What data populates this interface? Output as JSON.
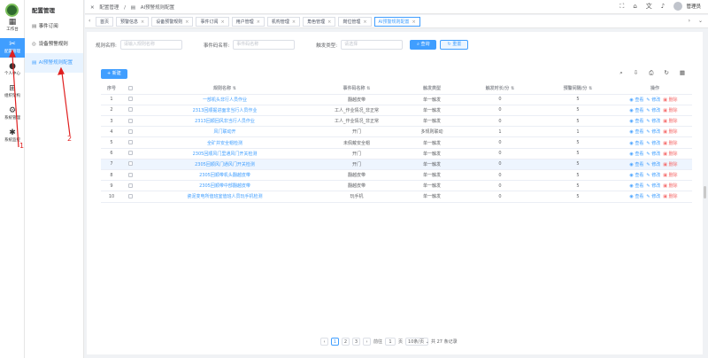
{
  "rail": {
    "items": [
      {
        "label": "工作台",
        "icon": "grid-icon",
        "glyph": "▦"
      },
      {
        "label": "配置管理",
        "icon": "tools-icon",
        "glyph": "✂"
      },
      {
        "label": "个人中心",
        "icon": "person-icon",
        "glyph": "●"
      },
      {
        "label": "组织架构",
        "icon": "org-icon",
        "glyph": "⊞"
      },
      {
        "label": "系统管理",
        "icon": "gear-icon",
        "glyph": "⚙"
      },
      {
        "label": "系统监控",
        "icon": "monitor-icon",
        "glyph": "✱"
      }
    ]
  },
  "submenu": {
    "title": "配置管理",
    "items": [
      {
        "label": "事件订阅",
        "glyph": "▤"
      },
      {
        "label": "设备预警规则",
        "glyph": "◎"
      },
      {
        "label": "AI预警规则配置",
        "glyph": "▤"
      }
    ]
  },
  "header": {
    "crumbs": [
      "配置管理",
      "/",
      "AI预警规则配置"
    ],
    "user": "管理员"
  },
  "tabs": [
    {
      "label": "首页",
      "closable": false
    },
    {
      "label": "预警信息",
      "closable": true
    },
    {
      "label": "设备预警规则",
      "closable": true
    },
    {
      "label": "事件订阅",
      "closable": true
    },
    {
      "label": "用户管理",
      "closable": true
    },
    {
      "label": "机构管理",
      "closable": true
    },
    {
      "label": "角色管理",
      "closable": true
    },
    {
      "label": "岗位管理",
      "closable": true
    },
    {
      "label": "AI预警规则配置",
      "closable": true
    }
  ],
  "search": {
    "rule_label": "规则名称:",
    "rule_placeholder": "请输入规则名称",
    "event_label": "事件码名称:",
    "event_placeholder": "事件码名称",
    "trigger_label": "触发类型:",
    "trigger_placeholder": "请选择",
    "query_btn": "查询",
    "reset_btn": "重置"
  },
  "new_btn": "新建",
  "table": {
    "headers": [
      "序号",
      "",
      "规则名称",
      "事件码名称",
      "触发类型",
      "触发时长/分",
      "预警间隔/分",
      "操作"
    ],
    "actions": {
      "view": "查看",
      "edit": "修改",
      "delete": "删除"
    },
    "rows": [
      {
        "idx": "1",
        "name": "一部机头非行人员作业",
        "event": "翻越皮带",
        "trigger": "单一触发",
        "dur": "0",
        "interval": "5"
      },
      {
        "idx": "2",
        "name": "2313回顺掘进面非当行人员作业",
        "event": "工人_作业情况_非正常",
        "trigger": "单一触发",
        "dur": "0",
        "interval": "5"
      },
      {
        "idx": "3",
        "name": "2313回顺回风非当行人员作业",
        "event": "工人_作业情况_非正常",
        "trigger": "单一触发",
        "dur": "0",
        "interval": "5"
      },
      {
        "idx": "4",
        "name": "风门联动开",
        "event": "开门",
        "trigger": "多规则联动",
        "dur": "1",
        "interval": "1"
      },
      {
        "idx": "5",
        "name": "全矿井安全帽检测",
        "event": "未佩戴安全帽",
        "trigger": "单一触发",
        "dur": "0",
        "interval": "5"
      },
      {
        "idx": "6",
        "name": "2305回顺风门里通风门开关检测",
        "event": "开门",
        "trigger": "单一触发",
        "dur": "0",
        "interval": "5"
      },
      {
        "idx": "7",
        "name": "2305回顺风门通风门开关检测",
        "event": "开门",
        "trigger": "单一触发",
        "dur": "0",
        "interval": "5"
      },
      {
        "idx": "8",
        "name": "2305回顺带机头翻越皮带",
        "event": "翻越皮带",
        "trigger": "单一触发",
        "dur": "0",
        "interval": "5"
      },
      {
        "idx": "9",
        "name": "2305回顺带中部翻越皮带",
        "event": "翻越皮带",
        "trigger": "单一触发",
        "dur": "0",
        "interval": "5"
      },
      {
        "idx": "10",
        "name": "瓷泥变电所值班室值班人员玩手机检测",
        "event": "玩手机",
        "trigger": "单一触发",
        "dur": "0",
        "interval": "5"
      }
    ]
  },
  "pagination": {
    "prev": "‹",
    "pages": [
      "1",
      "2",
      "3"
    ],
    "next": "›",
    "goto_label": "前往",
    "goto_value": "1",
    "page_suffix": "页",
    "page_size": "10条/页",
    "total": "共 27 条记录"
  },
  "annotations": {
    "one": "1",
    "two": "2"
  },
  "colors": {
    "primary": "#409eff",
    "danger": "#f56c6c",
    "annotation": "#e02020"
  }
}
